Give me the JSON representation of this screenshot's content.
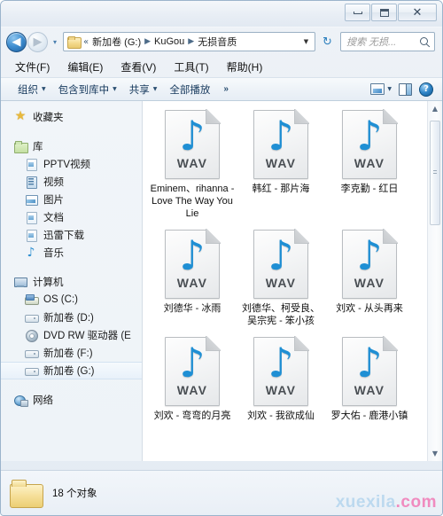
{
  "window": {
    "controls": {
      "minimize_label": "最小化",
      "restore_label": "向下还原",
      "close_label": "关闭"
    }
  },
  "address_bar": {
    "back_label": "◀",
    "forward_label": "▶",
    "history_caret": "▾",
    "folder_icon": "folder-icon",
    "overflow_chevron": "«",
    "breadcrumbs": [
      "新加卷 (G:)",
      "KuGou",
      "无损音质"
    ],
    "separator": "▶",
    "dropdown_caret": "▼",
    "refresh_label": "↻"
  },
  "search": {
    "placeholder": "搜索 无损...",
    "value": "",
    "icon": "search-icon"
  },
  "menu": {
    "items": [
      {
        "label": "文件(F)"
      },
      {
        "label": "编辑(E)"
      },
      {
        "label": "查看(V)"
      },
      {
        "label": "工具(T)"
      },
      {
        "label": "帮助(H)"
      }
    ]
  },
  "toolbar": {
    "organize_label": "组织",
    "include_library_label": "包含到库中",
    "share_label": "共享",
    "play_all_label": "全部播放",
    "overflow_label": "»",
    "caret": "▼",
    "view_mode_icon": "view-mode-icon",
    "view_mode_caret": "▼",
    "preview_pane_icon": "preview-pane-icon",
    "help_icon": "?"
  },
  "sidebar": {
    "groups": [
      {
        "name": "favorites",
        "header": {
          "label": "收藏夹",
          "icon": "star-icon"
        },
        "items": []
      },
      {
        "name": "libraries",
        "header": {
          "label": "库",
          "icon": "folder-icon"
        },
        "items": [
          {
            "label": "PPTV视频",
            "icon": "library-doc-icon"
          },
          {
            "label": "视频",
            "icon": "video-icon"
          },
          {
            "label": "图片",
            "icon": "picture-icon"
          },
          {
            "label": "文档",
            "icon": "document-icon"
          },
          {
            "label": "迅雷下载",
            "icon": "library-doc-icon"
          },
          {
            "label": "音乐",
            "icon": "music-note-icon"
          }
        ]
      },
      {
        "name": "computer",
        "header": {
          "label": "计算机",
          "icon": "computer-icon"
        },
        "items": [
          {
            "label": "OS (C:)",
            "icon": "os-drive-icon",
            "selected": false
          },
          {
            "label": "新加卷 (D:)",
            "icon": "drive-icon",
            "selected": false
          },
          {
            "label": "DVD RW 驱动器 (E",
            "icon": "dvd-drive-icon",
            "selected": false
          },
          {
            "label": "新加卷 (F:)",
            "icon": "drive-icon",
            "selected": false
          },
          {
            "label": "新加卷 (G:)",
            "icon": "drive-icon",
            "selected": true
          }
        ]
      },
      {
        "name": "network",
        "header": {
          "label": "网络",
          "icon": "network-icon"
        },
        "items": []
      }
    ]
  },
  "files": {
    "icon_type": "wav-file-icon",
    "icon_label": "WAV",
    "note_glyph": "♪",
    "items": [
      {
        "name": "Eminem、rihanna - Love The Way You Lie"
      },
      {
        "name": "韩红 - 那片海"
      },
      {
        "name": "李克勤 - 红日"
      },
      {
        "name": "刘德华 - 冰雨"
      },
      {
        "name": "刘德华、柯受良、吴宗宪 - 笨小孩"
      },
      {
        "name": "刘欢 - 从头再来"
      },
      {
        "name": "刘欢 - 弯弯的月亮"
      },
      {
        "name": "刘欢 - 我欲成仙"
      },
      {
        "name": "罗大佑 - 鹿港小镇"
      }
    ]
  },
  "scrollbar": {
    "up_arrow": "▲",
    "down_arrow": "▼"
  },
  "status_bar": {
    "text": "18 个对象",
    "folder_icon": "folder-icon"
  },
  "watermark": {
    "part1": "xuexila",
    "part2": ".com"
  }
}
